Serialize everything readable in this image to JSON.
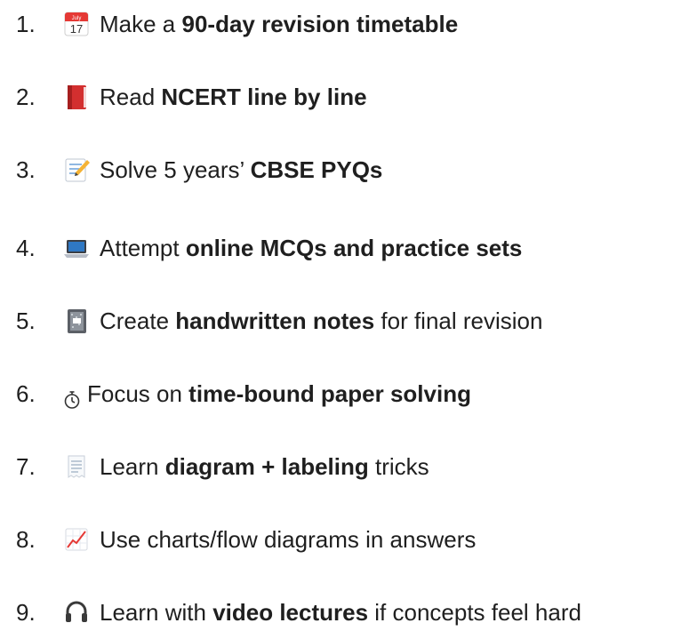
{
  "items": [
    {
      "num": "1.",
      "icon": "calendar-icon",
      "icon_month": "July",
      "icon_day": "17",
      "pre": "Make a ",
      "bold": "90-day revision timetable",
      "post": ""
    },
    {
      "num": "2.",
      "icon": "red-book-icon",
      "pre": "Read ",
      "bold": "NCERT line by line",
      "post": ""
    },
    {
      "num": "3.",
      "icon": "memo-pencil-icon",
      "pre": "Solve 5 years’ ",
      "bold": "CBSE PYQs",
      "post": ""
    },
    {
      "num": "4.",
      "icon": "laptop-icon",
      "pre": "Attempt ",
      "bold": "online MCQs and practice sets",
      "post": ""
    },
    {
      "num": "5.",
      "icon": "notebook-icon",
      "pre": "Create ",
      "bold": "handwritten notes",
      "post": " for final revision"
    },
    {
      "num": "6.",
      "icon": "stopwatch-icon",
      "pre": "Focus on ",
      "bold": "time-bound paper solving",
      "post": ""
    },
    {
      "num": "7.",
      "icon": "receipt-icon",
      "pre": "Learn ",
      "bold": "diagram + labeling",
      "post": " tricks"
    },
    {
      "num": "8.",
      "icon": "chart-increasing-icon",
      "pre": "Use charts/flow diagrams in answers",
      "bold": "",
      "post": ""
    },
    {
      "num": "9.",
      "icon": "headphones-icon",
      "pre": "Learn with ",
      "bold": "video lectures",
      "post": " if concepts feel hard"
    }
  ],
  "colors": {
    "text": "#1f1f1f",
    "calendar_red": "#e53935",
    "book_red": "#d32f2f",
    "laptop_screen": "#2f78c4",
    "chart_line": "#e53935",
    "headphones": "#3a3a3a"
  }
}
